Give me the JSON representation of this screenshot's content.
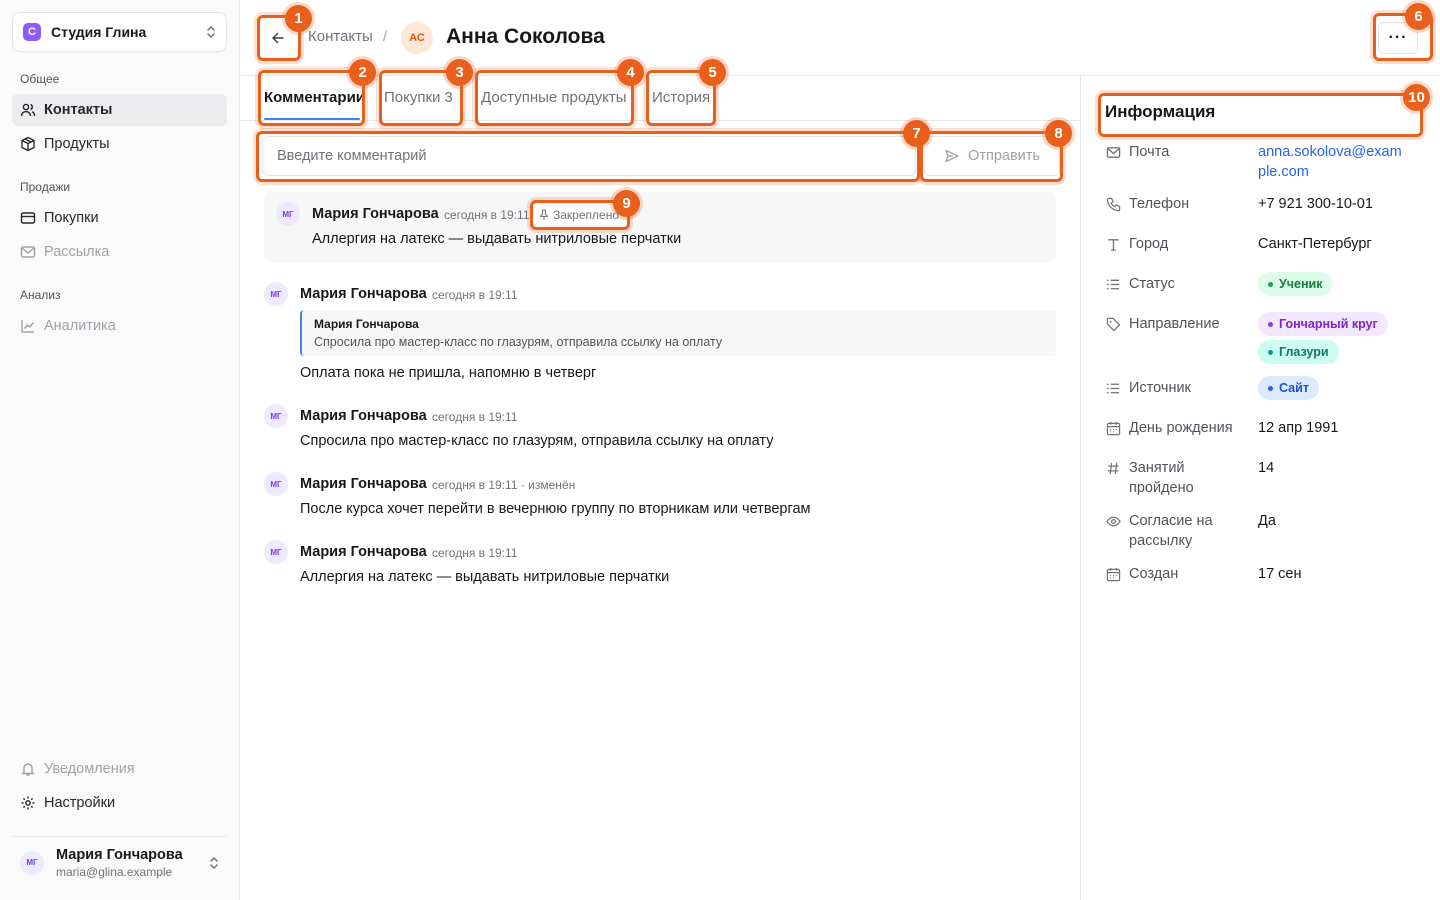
{
  "sidebar": {
    "org_name": "Студия Глина",
    "org_initial": "С",
    "sections": {
      "general": "Общее",
      "sales": "Продажи",
      "analysis": "Анализ"
    },
    "items": {
      "contacts": "Контакты",
      "products": "Продукты",
      "purchases": "Покупки",
      "mailing": "Рассылка",
      "analytics": "Аналитика",
      "notifications": "Уведомления",
      "settings": "Настройки"
    },
    "user": {
      "name": "Мария Гончарова",
      "email": "maria@glina.example",
      "initials": "МГ"
    }
  },
  "header": {
    "breadcrumb": "Контакты",
    "separator": "/",
    "avatar_initials": "АС",
    "title": "Анна Соколова",
    "more_label": "···"
  },
  "tabs": [
    {
      "label": "Комментарии",
      "active": true
    },
    {
      "label": "Покупки",
      "count": "3"
    },
    {
      "label": "Доступные продукты"
    },
    {
      "label": "История"
    }
  ],
  "composer": {
    "placeholder": "Введите комментарий",
    "send_label": "Отправить"
  },
  "comments": [
    {
      "initials": "МГ",
      "author": "Мария Гончарова",
      "time": "сегодня в 19:11",
      "pin_label": "Закреплено",
      "text": "Аллергия на латекс — выдавать нитриловые перчатки"
    },
    {
      "initials": "МГ",
      "author": "Мария Гончарова",
      "time": "сегодня в 19:11",
      "quote_author": "Мария Гончарова",
      "quote_text": "Спросила про мастер-класс по глазурям, отправила ссылку на оплату",
      "text": "Оплата пока не пришла, напомню в четверг"
    },
    {
      "initials": "МГ",
      "author": "Мария Гончарова",
      "time": "сегодня в 19:11",
      "text": "Спросила про мастер-класс по глазурям, отправила ссылку на оплату"
    },
    {
      "initials": "МГ",
      "author": "Мария Гончарова",
      "time": "сегодня в 19:11 · изменён",
      "text": "После курса хочет перейти в вечернюю группу по вторникам или четвергам"
    },
    {
      "initials": "МГ",
      "author": "Мария Гончарова",
      "time": "сегодня в 19:11",
      "text": "Аллергия на латекс — выдавать нитриловые перчатки"
    }
  ],
  "info": {
    "title": "Информация",
    "email_label": "Почта",
    "email": "anna.sokolova@example.com",
    "phone_label": "Телефон",
    "phone": "+7 921 300-10-01",
    "city_label": "Город",
    "city": "Санкт-Петербург",
    "status_label": "Статус",
    "status": "Ученик",
    "direction_label": "Направление",
    "direction_1": "Гончарный круг",
    "direction_2": "Глазури",
    "source_label": "Источник",
    "source": "Сайт",
    "birthday_label": "День рождения",
    "birthday": "12 апр 1991",
    "lessons_label": "Занятий пройдено",
    "lessons": "14",
    "consent_label": "Согласие на рассылку",
    "consent": "Да",
    "created_label": "Создан",
    "created": "17 сен"
  },
  "colors": {
    "accent": "#3b82f6",
    "annotation": "#e8601c",
    "status_green_bg": "#dcfce7",
    "status_green_text": "#15803d",
    "tag_purple_bg": "#f3e8ff",
    "tag_purple_text": "#7e22ce",
    "tag_teal_bg": "#ccfbf1",
    "tag_teal_text": "#0f766e",
    "tag_blue_bg": "#dbeafe",
    "tag_blue_text": "#1d4ed8"
  },
  "annotations": [
    "1",
    "2",
    "3",
    "4",
    "5",
    "6",
    "7",
    "8",
    "9",
    "10"
  ]
}
